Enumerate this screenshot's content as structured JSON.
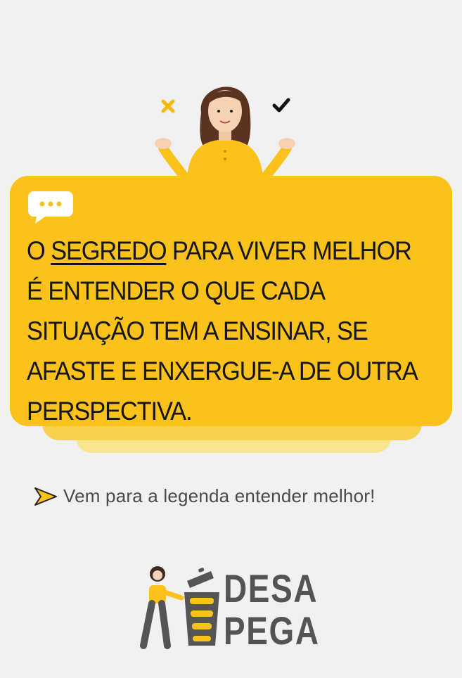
{
  "quote": {
    "part1": "O ",
    "highlight": "SEGREDO",
    "part2": " PARA VIVER MELHOR É ENTENDER O QUE CADA SITUAÇÃO TEM A ENSINAR, SE AFASTE E ENXERGUE-A DE OUTRA PERSPECTIVA."
  },
  "cta": {
    "text": "Vem para a legenda entender melhor!"
  },
  "logo": {
    "line1": "DESA",
    "line2": "PEGA"
  },
  "colors": {
    "accent": "#fbc21c",
    "background": "#f1f1f1",
    "text": "#161616",
    "muted": "#4a4a4a"
  },
  "icons": [
    "cross-icon",
    "check-icon",
    "chat-bubble-icon",
    "arrow-right-icon",
    "trash-bin-icon"
  ]
}
